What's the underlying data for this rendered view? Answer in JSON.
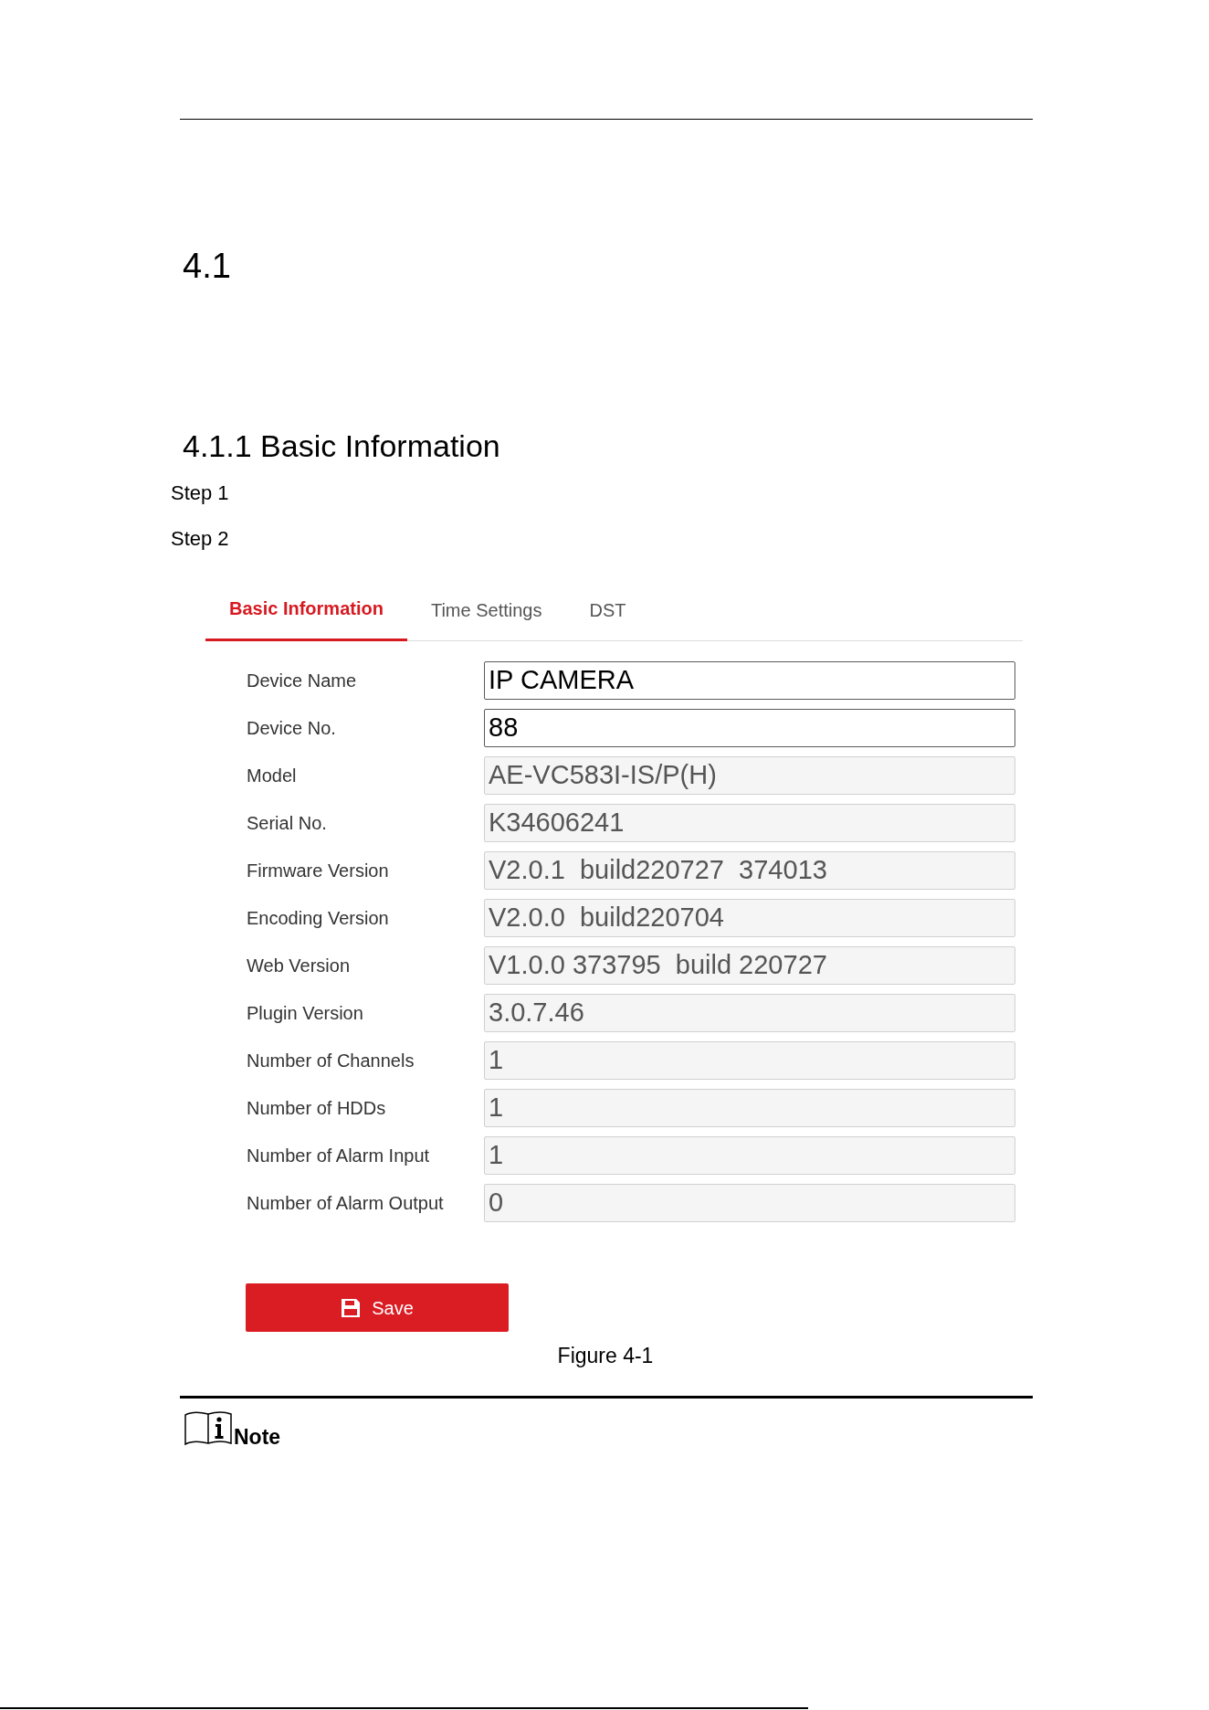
{
  "section_number": "4.1",
  "subsection_title": "4.1.1 Basic Information",
  "steps": [
    "Step 1",
    "Step 2"
  ],
  "figure": {
    "tabs": [
      {
        "label": "Basic Information",
        "selected": true
      },
      {
        "label": "Time Settings",
        "selected": false
      },
      {
        "label": "DST",
        "selected": false
      }
    ],
    "fields": [
      {
        "label": "Device Name",
        "value": "IP CAMERA",
        "disabled": false
      },
      {
        "label": "Device No.",
        "value": "88",
        "disabled": false
      },
      {
        "label": "Model",
        "value": "AE-VC583I-IS/P(H)",
        "disabled": true
      },
      {
        "label": "Serial No.",
        "value": "K34606241",
        "disabled": true
      },
      {
        "label": "Firmware Version",
        "value": "V2.0.1  build220727  374013",
        "disabled": true
      },
      {
        "label": "Encoding Version",
        "value": "V2.0.0  build220704",
        "disabled": true
      },
      {
        "label": "Web Version",
        "value": "V1.0.0 373795  build 220727",
        "disabled": true
      },
      {
        "label": "Plugin Version",
        "value": "3.0.7.46",
        "disabled": true
      },
      {
        "label": "Number of Channels",
        "value": "1",
        "disabled": true
      },
      {
        "label": "Number of HDDs",
        "value": "1",
        "disabled": true
      },
      {
        "label": "Number of Alarm Input",
        "value": "1",
        "disabled": true
      },
      {
        "label": "Number of Alarm Output",
        "value": "0",
        "disabled": true
      }
    ],
    "save_button": {
      "label": "Save"
    }
  },
  "caption": "Figure 4-1",
  "note": {
    "label": "Note"
  }
}
